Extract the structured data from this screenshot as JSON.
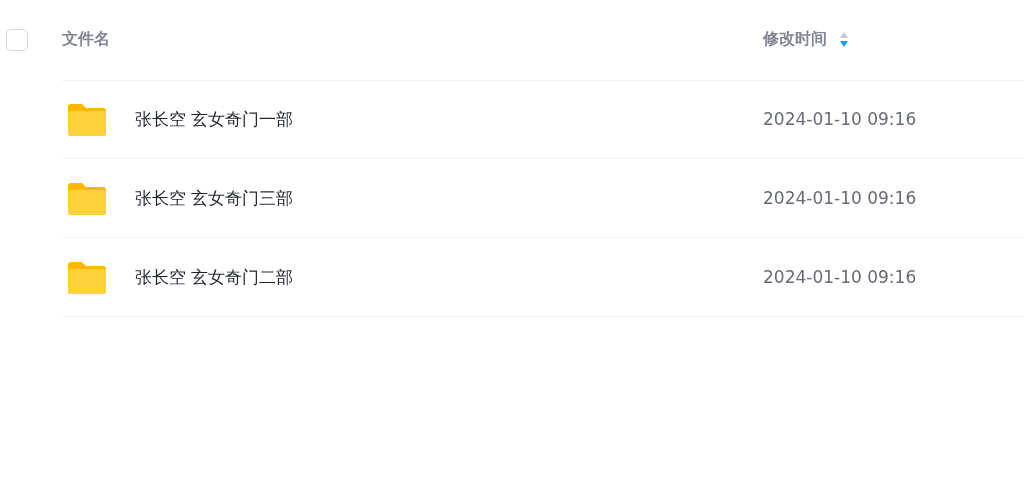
{
  "header": {
    "select_all_checked": false,
    "columns": [
      {
        "label": "文件名"
      },
      {
        "label": "修改时间",
        "sorted": true,
        "descending": true
      }
    ]
  },
  "rows": [
    {
      "kind": "folder",
      "name": "张长空 玄女奇门一部",
      "modified": "2024-01-10 09:16"
    },
    {
      "kind": "folder",
      "name": "张长空 玄女奇门三部",
      "modified": "2024-01-10 09:16"
    },
    {
      "kind": "folder",
      "name": "张长空 玄女奇门二部",
      "modified": "2024-01-10 09:16"
    }
  ]
}
